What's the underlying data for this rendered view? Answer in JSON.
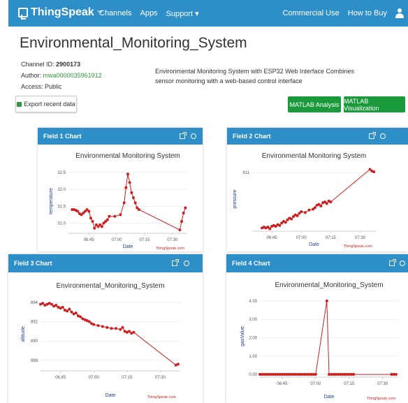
{
  "nav": {
    "brand": "ThingSpeak",
    "brand_tm": "™",
    "links": [
      "Channels",
      "Apps",
      "Support ▾"
    ],
    "right_links": [
      "Commercial Use",
      "How to Buy"
    ]
  },
  "channel": {
    "title": "Environmental_Monitoring_System",
    "id_label": "Channel ID:",
    "id_value": "2900173",
    "author_label": "Author:",
    "author_value": "mwa0000035961912",
    "access_label": "Access:",
    "access_value": "Public",
    "description": "Environmental Monitoring System with ESP32 Web Interface Combines sensor monitoring with a web-based control interface"
  },
  "buttons": {
    "export": "Export recent data",
    "matlab_analysis": "MATLAB Analysis",
    "matlab_visualization": "MATLAB Visualization"
  },
  "colors": {
    "accent": "#2e8ec7",
    "green": "#1a9a3b",
    "series": "#cc1f1f"
  },
  "chart_data": [
    {
      "type": "line",
      "panel_title": "Field 1 Chart",
      "title": "Environmental Monitoring System",
      "xlabel": "Date",
      "ylabel": "temperature",
      "credit": "ThingSpeak.com",
      "x_ticks": [
        "06:45",
        "07:00",
        "07:15",
        "07:30"
      ],
      "y_ticks": [
        "31.0",
        "31.5",
        "32.0",
        "32.5"
      ],
      "x_range_minutes": [
        34,
        98
      ],
      "ylim": [
        30.7,
        32.6
      ],
      "x": [
        36,
        37,
        38,
        39,
        40,
        41,
        42,
        43,
        44,
        45,
        46,
        47,
        48,
        49,
        50,
        51,
        52,
        53,
        54,
        55,
        56,
        59,
        62,
        64,
        65,
        66,
        67,
        68,
        69,
        70,
        71,
        72,
        94,
        95,
        96,
        97
      ],
      "y": [
        31.4,
        31.4,
        31.38,
        31.35,
        31.28,
        31.25,
        31.3,
        31.35,
        31.4,
        31.35,
        31.15,
        31.05,
        30.85,
        30.95,
        30.9,
        30.95,
        30.9,
        31.0,
        31.05,
        31.1,
        31.2,
        31.2,
        31.25,
        31.6,
        32.05,
        32.45,
        32.2,
        31.9,
        31.75,
        31.6,
        31.45,
        31.4,
        30.8,
        31.05,
        31.3,
        31.45
      ]
    },
    {
      "type": "line",
      "panel_title": "Field 2 Chart",
      "title": "Environmental Monitoring System",
      "xlabel": "Date",
      "ylabel": "pressure",
      "credit": "ThingSpeak.com",
      "x_ticks": [
        "06:45",
        "07:00",
        "07:15",
        "07:30"
      ],
      "y_ticks": [
        "911"
      ],
      "x_range_minutes": [
        35,
        98
      ],
      "ylim": [
        903.8,
        911.7
      ],
      "x": [
        40,
        41,
        42,
        43,
        44,
        45,
        46,
        47,
        48,
        49,
        50,
        51,
        52,
        53,
        54,
        55,
        56,
        57,
        58,
        59,
        60,
        62,
        64,
        66,
        67,
        68,
        69,
        70,
        71,
        72,
        73,
        74,
        75,
        95,
        96,
        97
      ],
      "y": [
        904.2,
        904.3,
        904.2,
        904.3,
        904.1,
        904.4,
        904.5,
        904.4,
        904.6,
        904.5,
        904.8,
        905.0,
        904.9,
        905.2,
        905.4,
        905.3,
        905.6,
        905.8,
        905.7,
        906.0,
        906.2,
        906.1,
        906.4,
        906.5,
        906.7,
        907.0,
        907.1,
        906.9,
        907.3,
        907.4,
        907.2,
        907.5,
        907.4,
        911.4,
        911.2,
        911.1
      ]
    },
    {
      "type": "line",
      "panel_title": "Field 3 Chart",
      "title": "Environmental_Monitoring_System",
      "xlabel": "Date",
      "ylabel": "altitude",
      "credit": "ThingSpeak.com",
      "x_ticks": [
        "06:45",
        "07:00",
        "07:15",
        "07:30"
      ],
      "y_ticks": [
        "888",
        "890",
        "892",
        "894"
      ],
      "x_range_minutes": [
        36,
        99
      ],
      "ylim": [
        886.9,
        894.5
      ],
      "x": [
        36,
        37,
        38,
        39,
        40,
        41,
        42,
        43,
        44,
        45,
        46,
        47,
        48,
        49,
        50,
        51,
        52,
        53,
        54,
        55,
        56,
        57,
        58,
        59,
        60,
        62,
        64,
        66,
        68,
        70,
        72,
        73,
        74,
        75,
        76,
        77,
        78,
        97,
        98
      ],
      "y": [
        893.8,
        893.9,
        893.7,
        893.8,
        893.9,
        893.8,
        893.6,
        893.7,
        893.5,
        893.4,
        893.5,
        893.2,
        893.1,
        893.3,
        893.0,
        892.8,
        892.9,
        892.6,
        892.5,
        892.3,
        892.2,
        892.1,
        892.0,
        891.8,
        891.7,
        891.6,
        891.5,
        891.4,
        891.3,
        891.3,
        891.2,
        891.4,
        891.0,
        890.9,
        891.0,
        890.8,
        890.9,
        887.5,
        887.6
      ]
    },
    {
      "type": "line",
      "panel_title": "Field 4 Chart",
      "title": "Environmental_Monitoring_System",
      "xlabel": "Date",
      "ylabel": "gasValue",
      "credit": "ThingSpeak.com",
      "x_ticks": [
        "06:45",
        "07:00",
        "07:15",
        "07:30"
      ],
      "y_ticks": [
        "0.00",
        "1.00",
        "2.00",
        "3.00",
        "4.00"
      ],
      "x_range_minutes": [
        35,
        97
      ],
      "ylim": [
        -0.15,
        4.3
      ],
      "x": [
        35,
        36,
        37,
        38,
        39,
        40,
        41,
        42,
        43,
        44,
        45,
        46,
        47,
        48,
        49,
        50,
        51,
        52,
        53,
        54,
        55,
        56,
        57,
        58,
        59,
        60,
        65,
        66,
        67,
        68,
        69,
        70,
        71,
        72,
        73,
        74,
        75,
        76,
        77,
        94,
        95,
        96
      ],
      "y": [
        0,
        0,
        0,
        0,
        0,
        0,
        0,
        0,
        0,
        0,
        0,
        0,
        0,
        0,
        0,
        0,
        0,
        0,
        0,
        0,
        0,
        0,
        0,
        0,
        0,
        0,
        4,
        0,
        0,
        0,
        0,
        0,
        0,
        0,
        0,
        0,
        0,
        0,
        0,
        0,
        0,
        0
      ]
    }
  ]
}
